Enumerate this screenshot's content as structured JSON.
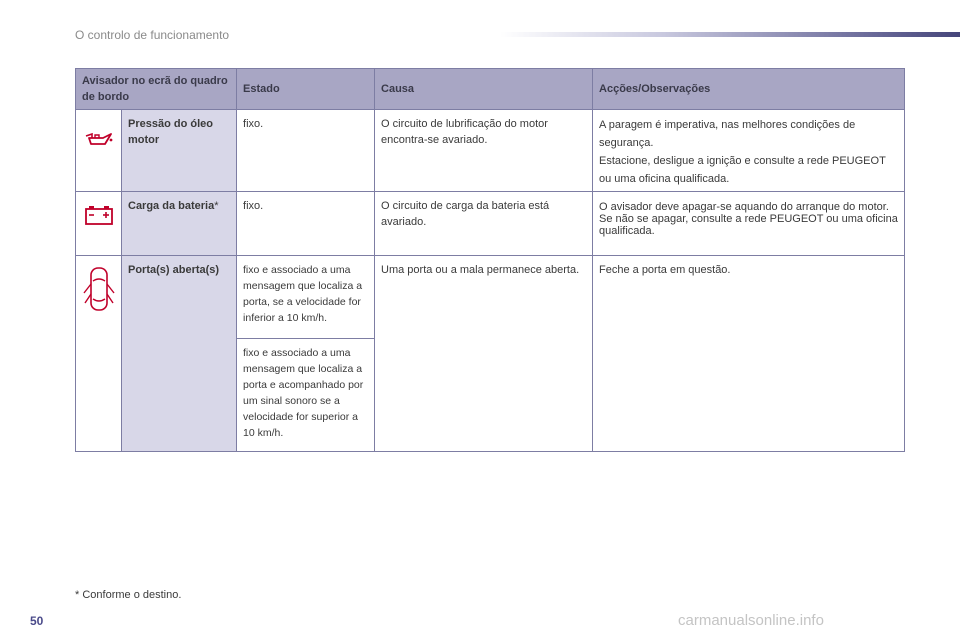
{
  "header": {
    "title": "O controlo de funcionamento"
  },
  "table": {
    "columns": [
      "Avisador no ecrã do quadro de bordo",
      "Estado",
      "Causa",
      "Acções/Observações"
    ],
    "rows": [
      {
        "icon": "oil-can-icon",
        "name": "Pressão do óleo motor",
        "estado": "fixo.",
        "causa": "O circuito de lubrificação do motor encontra-se avariado.",
        "accoes": [
          "A paragem é imperativa, nas melhores condições de segurança.",
          "Estacione, desligue a ignição e consulte a rede PEUGEOT ou uma oficina qualificada."
        ]
      },
      {
        "icon": "battery-icon",
        "name": "Carga da bateria",
        "name_mark": "*",
        "estado": "fixo.",
        "causa": "O circuito de carga da bateria está avariado.",
        "accoes": [
          "O avisador deve apagar-se aquando do arranque do motor.",
          "Se não se apagar, consulte a rede PEUGEOT ou uma oficina qualificada."
        ]
      },
      {
        "icon": "door-open-icon",
        "name": "Porta(s) aberta(s)",
        "estado": [
          "fixo e associado a uma mensagem que localiza a porta, se a velocidade for inferior a 10 km/h.",
          "fixo e associado a uma mensagem que localiza a porta e acompanhado por um sinal sonoro se a velocidade for superior a 10 km/h."
        ],
        "causa": "Uma porta ou a mala permanece aberta.",
        "accoes": [
          "Feche a porta em questão."
        ]
      }
    ]
  },
  "footnote": "* Conforme o destino.",
  "page_number": "50",
  "watermark": "carmanualsonline.info"
}
